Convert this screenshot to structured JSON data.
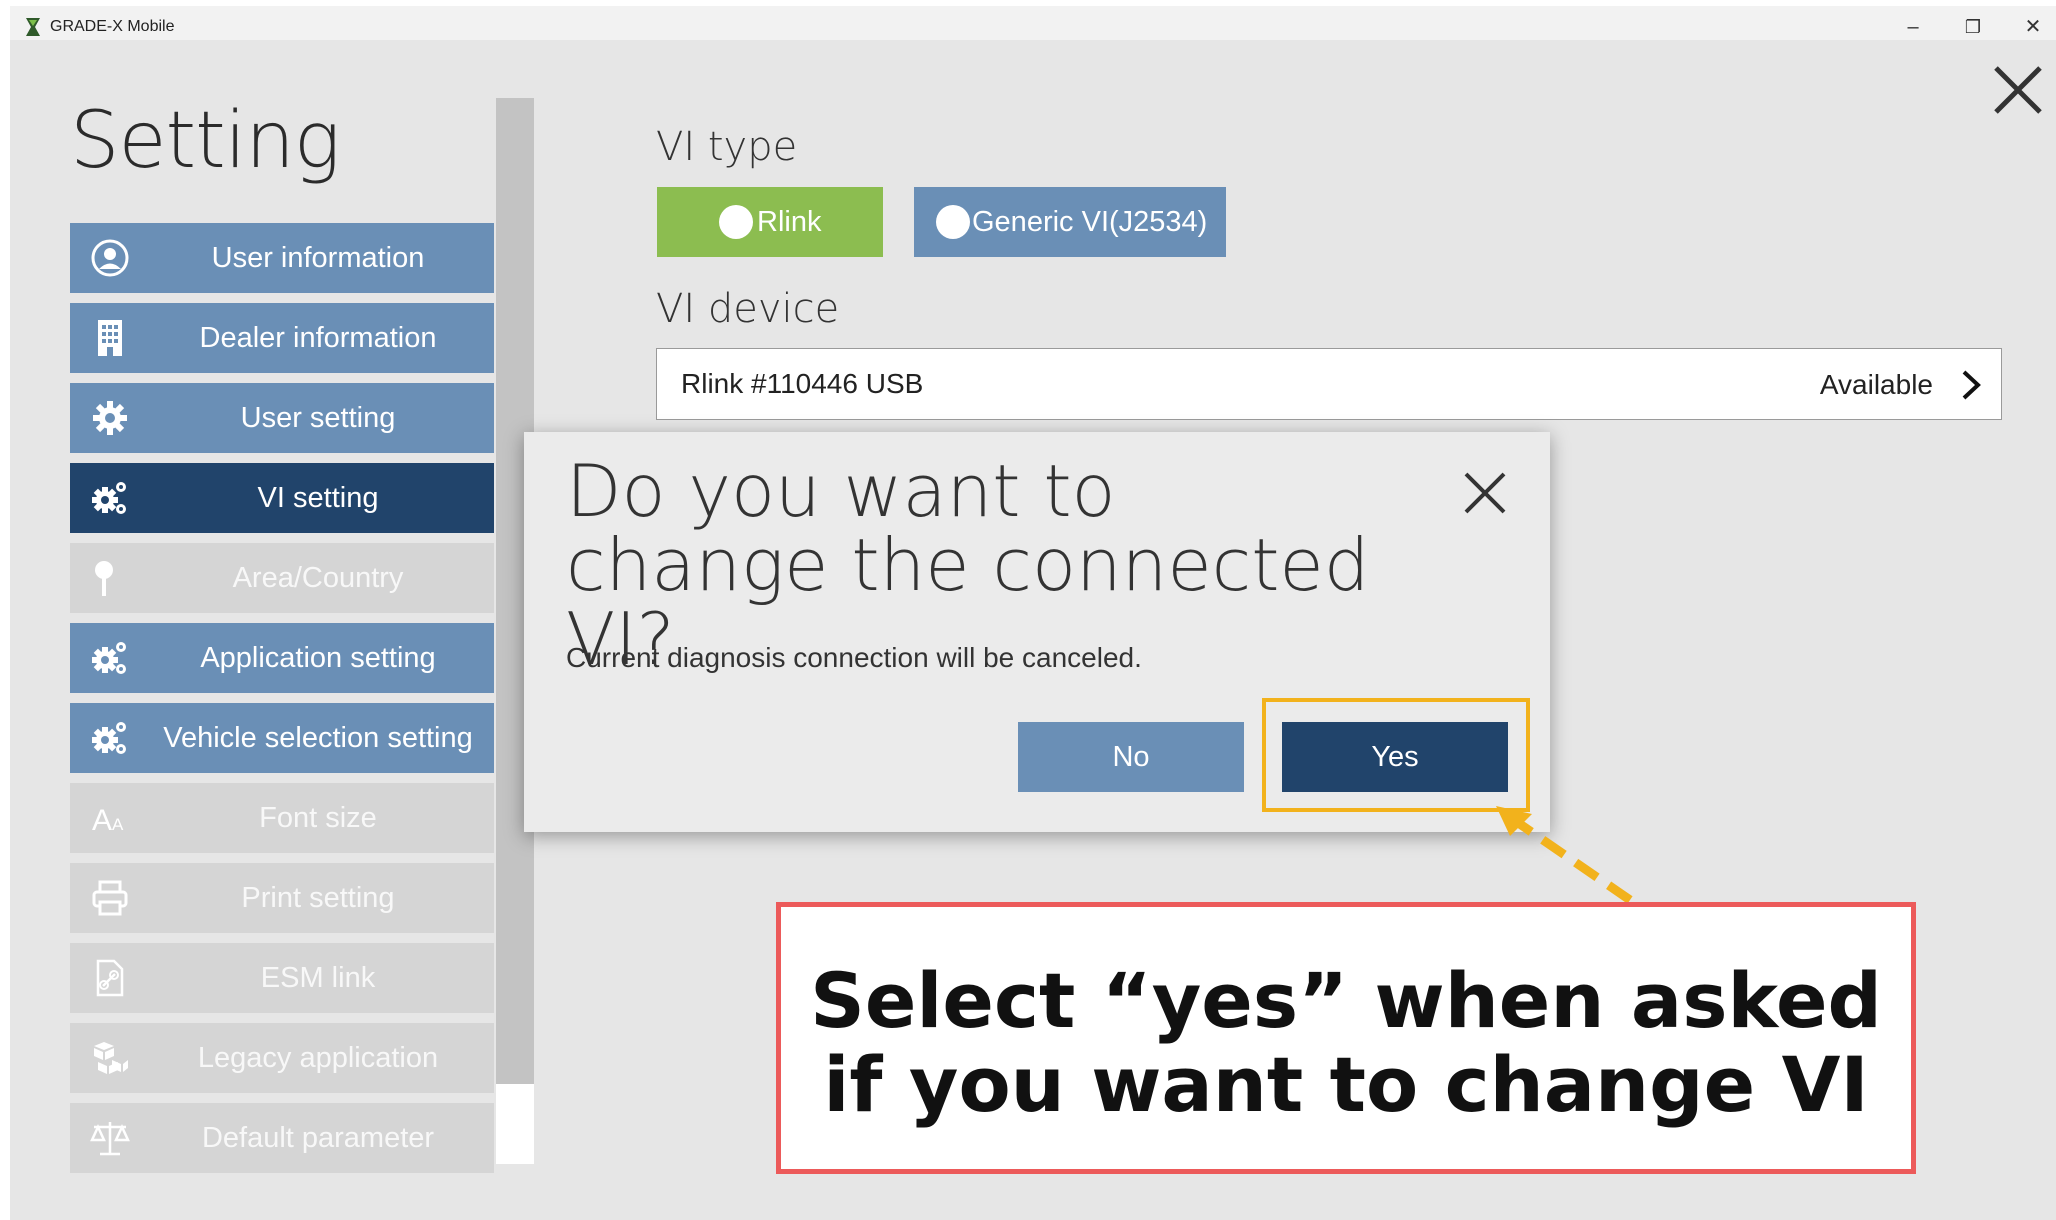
{
  "titlebar": {
    "title": "GRADE-X Mobile",
    "minimize": "–",
    "restore": "❐",
    "close": "✕"
  },
  "page": {
    "title": "Setting"
  },
  "sidebar": {
    "items": [
      {
        "label": "User information",
        "icon": "user-circle-icon",
        "state": "normal"
      },
      {
        "label": "Dealer information",
        "icon": "building-icon",
        "state": "normal"
      },
      {
        "label": "User setting",
        "icon": "gear-icon",
        "state": "normal"
      },
      {
        "label": "VI setting",
        "icon": "gears-icon",
        "state": "active"
      },
      {
        "label": "Area/Country",
        "icon": "map-pin-icon",
        "state": "disabled"
      },
      {
        "label": "Application setting",
        "icon": "gears-icon",
        "state": "normal"
      },
      {
        "label": "Vehicle selection setting",
        "icon": "gears-icon",
        "state": "normal"
      },
      {
        "label": "Font size",
        "icon": "font-size-icon",
        "state": "disabled"
      },
      {
        "label": "Print setting",
        "icon": "printer-icon",
        "state": "disabled"
      },
      {
        "label": "ESM link",
        "icon": "document-link-icon",
        "state": "disabled"
      },
      {
        "label": "Legacy application",
        "icon": "boxes-icon",
        "state": "disabled"
      },
      {
        "label": "Default parameter",
        "icon": "scale-icon",
        "state": "disabled"
      }
    ]
  },
  "vi": {
    "type_label": "VI type",
    "options": [
      {
        "label": "Rlink",
        "selected": true
      },
      {
        "label": "Generic VI(J2534)",
        "selected": false
      }
    ],
    "device_label": "VI device",
    "device_name": "Rlink #110446 USB",
    "device_status": "Available"
  },
  "dialog": {
    "title": "Do you want to change the connected VI?",
    "message": "Current diagnosis connection will be canceled.",
    "no_label": "No",
    "yes_label": "Yes"
  },
  "callout": {
    "text": "Select “yes” when asked if you want to change VI"
  },
  "colors": {
    "nav_blue": "#6a8fb6",
    "nav_active": "#21446b",
    "nav_disabled": "#d5d5d5",
    "rlink_green": "#8cbd50",
    "highlight": "#f2b21c",
    "callout_border": "#ec5a5a"
  }
}
